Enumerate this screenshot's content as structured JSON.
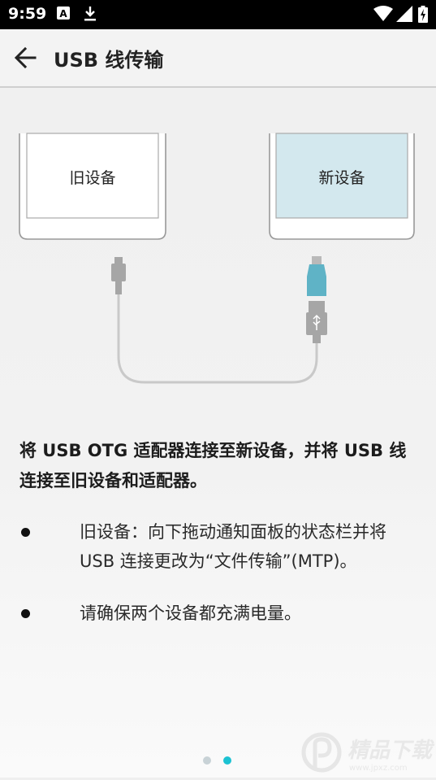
{
  "status_bar": {
    "time": "9:59",
    "icons": [
      "a-notification-icon",
      "download-icon",
      "wifi-icon",
      "signal-icon",
      "battery-charging-icon"
    ]
  },
  "app_bar": {
    "back_icon": "arrow-left-icon",
    "title": "USB 线传输"
  },
  "diagram": {
    "old_device_label": "旧设备",
    "new_device_label": "新设备",
    "colors": {
      "new_device_screen": "#d3e8ee",
      "otg_adapter": "#5fb3c6",
      "cable": "#c9c9c9",
      "connector": "#a6a6a6"
    }
  },
  "instruction": "将 USB OTG 适配器连接至新设备，并将 USB 线连接至旧设备和适配器。",
  "bullets": [
    {
      "text": "旧设备：向下拖动通知面板的状态栏并将 USB 连接更改为“文件传输”(MTP)。"
    },
    {
      "text": "请确保两个设备都充满电量。"
    }
  ],
  "pager": {
    "current_page": 2,
    "total_pages": 2,
    "inactive_color": "#c8d2d6",
    "active_color": "#1cc2d2"
  },
  "watermark": {
    "text": "精品下载",
    "url_text": "www.jpxz.com"
  }
}
